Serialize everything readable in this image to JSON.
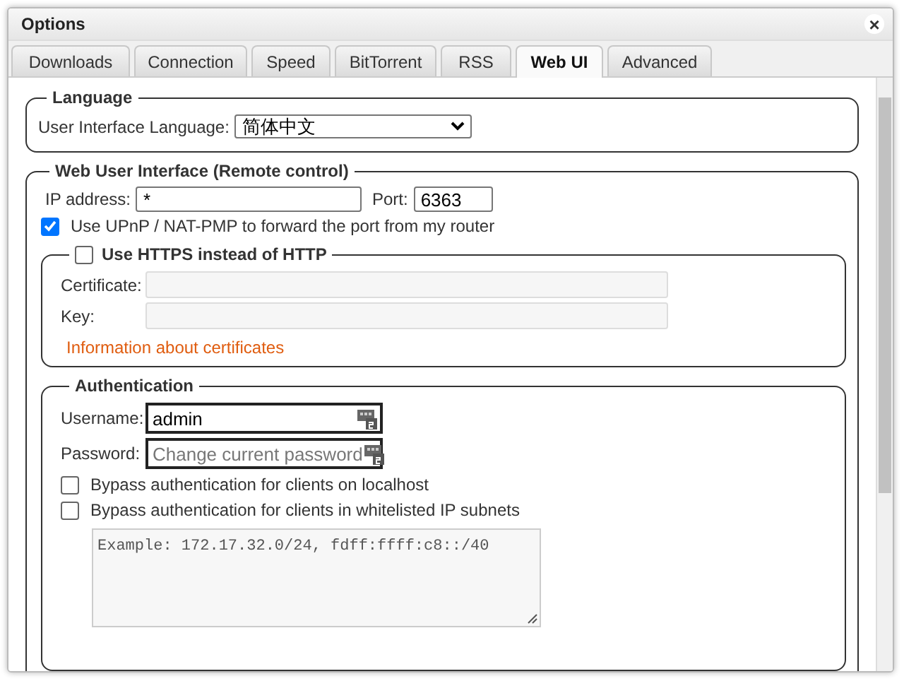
{
  "window": {
    "title": "Options",
    "close": "×"
  },
  "tabs": [
    {
      "label": "Downloads",
      "selected": false
    },
    {
      "label": "Connection",
      "selected": false
    },
    {
      "label": "Speed",
      "selected": false
    },
    {
      "label": "BitTorrent",
      "selected": false
    },
    {
      "label": "RSS",
      "selected": false
    },
    {
      "label": "Web UI",
      "selected": true
    },
    {
      "label": "Advanced",
      "selected": false
    }
  ],
  "language": {
    "legend": "Language",
    "label": "User Interface Language:",
    "value": "简体中文"
  },
  "web_ui": {
    "legend": "Web User Interface (Remote control)",
    "ip_label": "IP address:",
    "ip_value": "*",
    "port_label": "Port:",
    "port_value": "6363",
    "upnp": {
      "label": "Use UPnP / NAT-PMP to forward the port from my router",
      "checked": true
    },
    "https": {
      "label": "Use HTTPS instead of HTTP",
      "checked": false,
      "certificate_label": "Certificate:",
      "key_label": "Key:",
      "link": "Information about certificates"
    }
  },
  "authentication": {
    "legend": "Authentication",
    "username_label": "Username:",
    "username_value": "admin",
    "password_label": "Password:",
    "password_placeholder": "Change current password",
    "bypass": [
      {
        "label": "Bypass authentication for clients on localhost",
        "checked": false
      },
      {
        "label": "Bypass authentication for clients in whitelisted IP subnets",
        "checked": false
      }
    ],
    "subnets_placeholder": "Example: 172.17.32.0/24, fdff:ffff:c8::/40"
  }
}
